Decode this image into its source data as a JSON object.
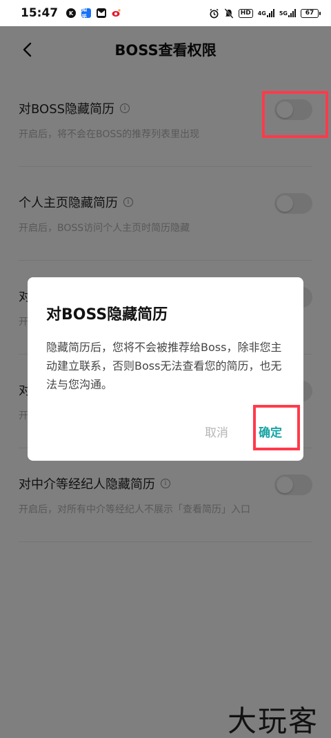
{
  "status_bar": {
    "time": "15:47",
    "apps": [
      {
        "icon": "k-icon",
        "label": "K"
      },
      {
        "icon": "zhihu-icon",
        "label": "知乎"
      },
      {
        "icon": "mail-icon",
        "label": ""
      },
      {
        "icon": "weibo-icon",
        "label": ""
      }
    ],
    "network_4g": "4G",
    "network_5g": "5G",
    "hd_label": "HD",
    "battery": "67"
  },
  "nav": {
    "title": "BOSS查看权限",
    "back_icon": "chevron-left-icon"
  },
  "settings": [
    {
      "title": "对BOSS隐藏简历",
      "desc": "开启后，将不会在BOSS的推荐列表里出现",
      "enabled": false
    },
    {
      "title": "个人主页隐藏简历",
      "desc": "开启后，BOSS访问个人主页时简历隐藏",
      "enabled": false
    },
    {
      "title": "对",
      "desc": "开",
      "enabled": false
    },
    {
      "title": "对",
      "desc": "开",
      "enabled": false
    },
    {
      "title": "对中介等经纪人隐藏简历",
      "desc": "开启后，对所有中介等经纪人不展示「查看简历」入口",
      "enabled": false
    }
  ],
  "dialog": {
    "title": "对BOSS隐藏简历",
    "message": "隐藏简历后，您将不会被推荐给Boss，除非您主动建立联系，否则Boss无法查看您的简历，也无法与您沟通。",
    "cancel_label": "取消",
    "confirm_label": "确定"
  },
  "colors": {
    "accent": "#16a3a3",
    "highlight": "#ff3a4a",
    "overlay": "#000000"
  },
  "watermark": "大玩客"
}
